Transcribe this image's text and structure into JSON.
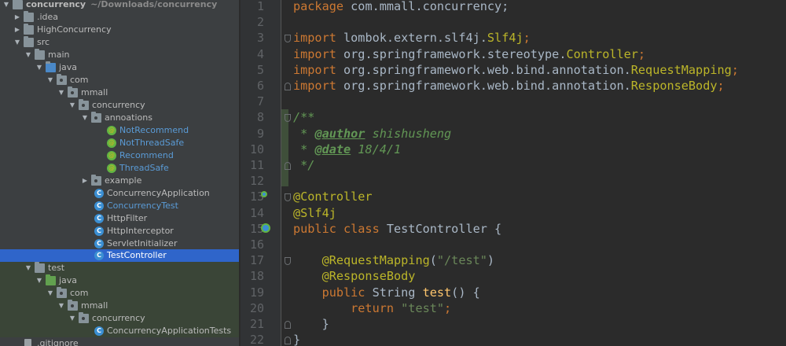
{
  "project_tree": {
    "root": {
      "name": "concurrency",
      "path": "~/Downloads/concurrency"
    },
    "items": [
      {
        "label": ".idea",
        "type": "folder"
      },
      {
        "label": "HighConcurrency",
        "type": "folder"
      },
      {
        "label": "src",
        "type": "folder"
      },
      {
        "label": "main",
        "type": "folder"
      },
      {
        "label": "java",
        "type": "source-folder"
      },
      {
        "label": "com",
        "type": "package"
      },
      {
        "label": "mmall",
        "type": "package"
      },
      {
        "label": "concurrency",
        "type": "package"
      },
      {
        "label": "annoations",
        "type": "package"
      },
      {
        "label": "NotRecommend",
        "type": "annotation"
      },
      {
        "label": "NotThreadSafe",
        "type": "annotation"
      },
      {
        "label": "Recommend",
        "type": "annotation"
      },
      {
        "label": "ThreadSafe",
        "type": "annotation"
      },
      {
        "label": "example",
        "type": "package"
      },
      {
        "label": "ConcurrencyApplication",
        "type": "class"
      },
      {
        "label": "ConcurrencyTest",
        "type": "class"
      },
      {
        "label": "HttpFilter",
        "type": "class"
      },
      {
        "label": "HttpInterceptor",
        "type": "class"
      },
      {
        "label": "ServletInitializer",
        "type": "class"
      },
      {
        "label": "TestController",
        "type": "class",
        "selected": true
      },
      {
        "label": "test",
        "type": "folder"
      },
      {
        "label": "java",
        "type": "test-folder"
      },
      {
        "label": "com",
        "type": "package"
      },
      {
        "label": "mmall",
        "type": "package"
      },
      {
        "label": "concurrency",
        "type": "package"
      },
      {
        "label": "ConcurrencyApplicationTests",
        "type": "class"
      },
      {
        "label": ".gitignore",
        "type": "file"
      }
    ]
  },
  "editor": {
    "line_numbers": [
      "1",
      "2",
      "3",
      "4",
      "5",
      "6",
      "7",
      "8",
      "9",
      "10",
      "11",
      "12",
      "13",
      "14",
      "15",
      "16",
      "17",
      "18",
      "19",
      "20",
      "21",
      "22"
    ],
    "code": {
      "l1_kw": "package",
      "l1_rest": " com.mmall.concurrency;",
      "l3_kw": "import",
      "l3_pkg": " lombok.extern.slf4j.",
      "l3_cls": "Slf4j",
      "l3_end": ";",
      "l4_kw": "import",
      "l4_pkg": " org.springframework.stereotype.",
      "l4_cls": "Controller",
      "l4_end": ";",
      "l5_kw": "import",
      "l5_pkg": " org.springframework.web.bind.annotation.",
      "l5_cls": "RequestMapping",
      "l5_end": ";",
      "l6_kw": "import",
      "l6_pkg": " org.springframework.web.bind.annotation.",
      "l6_cls": "ResponseBody",
      "l6_end": ";",
      "l8": "/**",
      "l9_star": " * ",
      "l9_tag": "@author",
      "l9_val": " shishusheng",
      "l10_star": " * ",
      "l10_tag": "@date",
      "l10_val": " 18/4/1",
      "l11": " */",
      "l13": "@Controller",
      "l14": "@Slf4j",
      "l15_kw": "public class",
      "l15_name": " TestController {",
      "l17_ann": "    @RequestMapping",
      "l17_open": "(",
      "l17_str": "\"/test\"",
      "l17_close": ")",
      "l18": "    @ResponseBody",
      "l19_kw": "    public",
      "l19_type": " String ",
      "l19_fn": "test",
      "l19_end": "() {",
      "l20_kw": "        return",
      "l20_str": " \"test\"",
      "l20_end": ";",
      "l21": "    }",
      "l22": "}"
    }
  }
}
